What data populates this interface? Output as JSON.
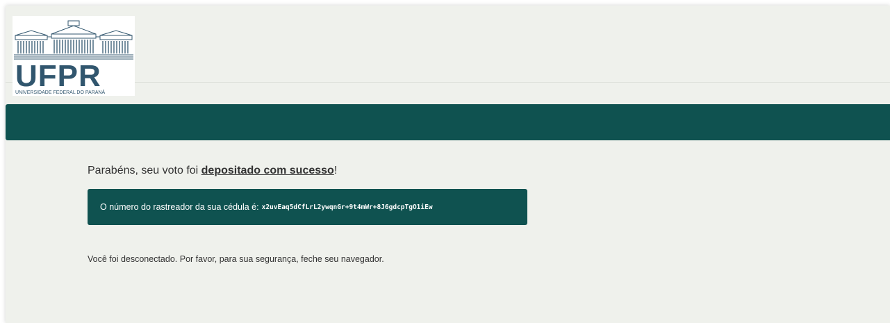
{
  "header": {
    "logo": {
      "icon": "ufpr-building-icon",
      "brand_text": "UFPR",
      "subtitle": "UNIVERSIDADE FEDERAL DO PARANÁ",
      "brand_color": "#31566e"
    }
  },
  "colors": {
    "accent": "#0f5250",
    "background": "#eff1ec"
  },
  "message": {
    "prefix": "Parabéns, seu voto foi ",
    "emphasis": "depositado com sucesso",
    "suffix": "!"
  },
  "tracker": {
    "label": "O número do rastreador da sua cédula é:",
    "code": "x2uvEaq5dCfLrL2ywqnGr+9t4mWr+8J6gdcpTgO1iEw"
  },
  "logout_notice": "Você foi desconectado. Por favor, para sua segurança, feche seu navegador."
}
